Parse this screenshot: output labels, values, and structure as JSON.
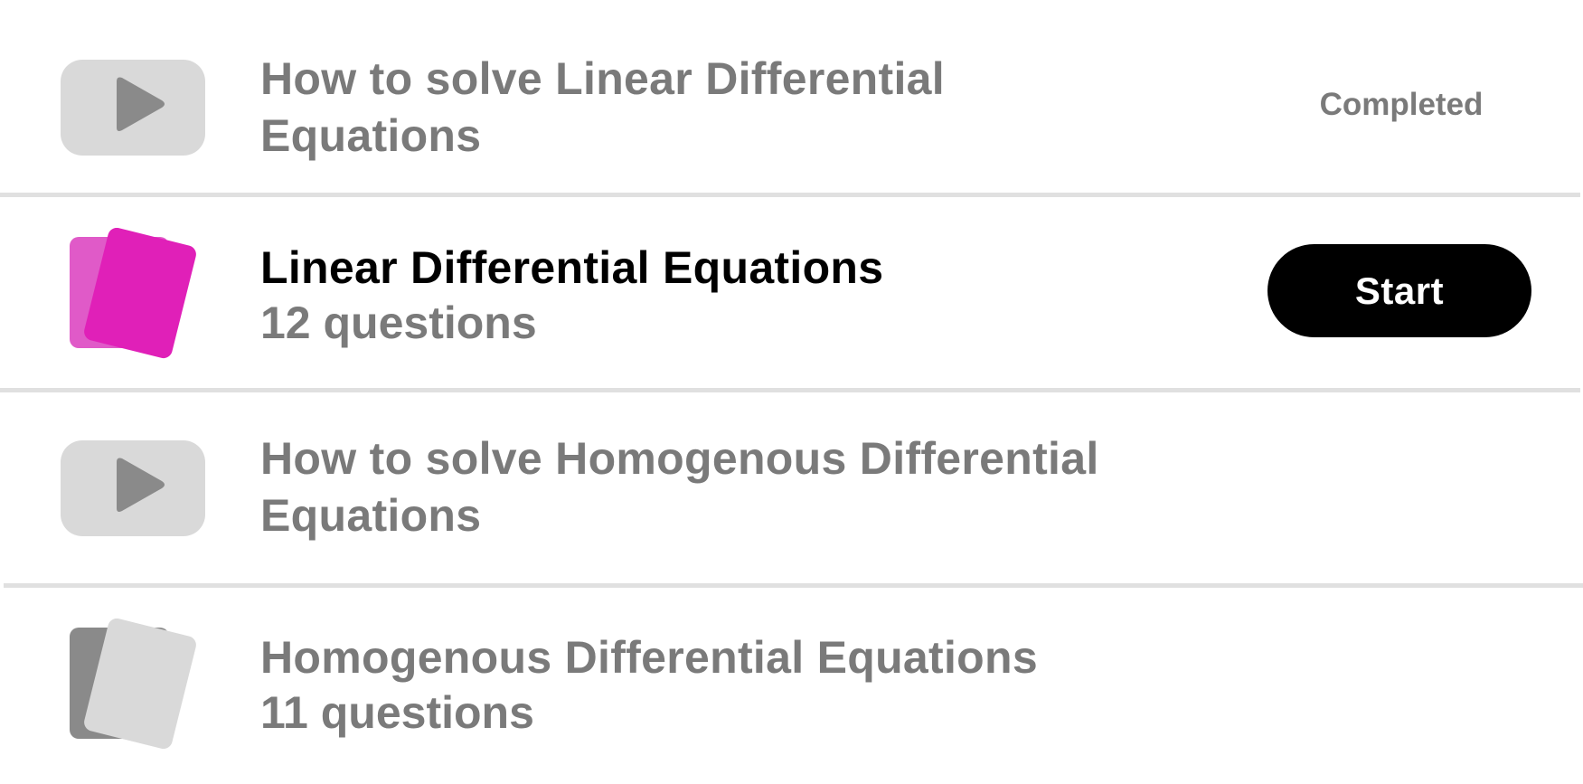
{
  "items": [
    {
      "kind": "video",
      "title_line1": "How to solve Linear Differential",
      "title_line2": "Equations",
      "status": "Completed",
      "icon": "play-icon"
    },
    {
      "kind": "quiz",
      "title": "Linear Differential Equations",
      "subtitle": "12 questions",
      "action_label": "Start",
      "icon": "flashcards-icon",
      "accent_front": "#e020b8",
      "accent_back": "#e05ac8"
    },
    {
      "kind": "video",
      "title_line1": "How to solve Homogenous Differential",
      "title_line2": "Equations",
      "icon": "play-icon"
    },
    {
      "kind": "quiz",
      "title": "Homogenous Differential Equations",
      "subtitle": "11 questions",
      "icon": "flashcards-icon",
      "accent_front": "#d9d9d9",
      "accent_back": "#8a8a8a"
    }
  ],
  "colors": {
    "muted_text": "#7a7a7a",
    "active_text": "#000000",
    "divider": "#e0e0e0",
    "thumb_bg": "#d9d9d9",
    "play_glyph": "#8a8a8a",
    "button_bg": "#000000",
    "button_text": "#ffffff"
  }
}
